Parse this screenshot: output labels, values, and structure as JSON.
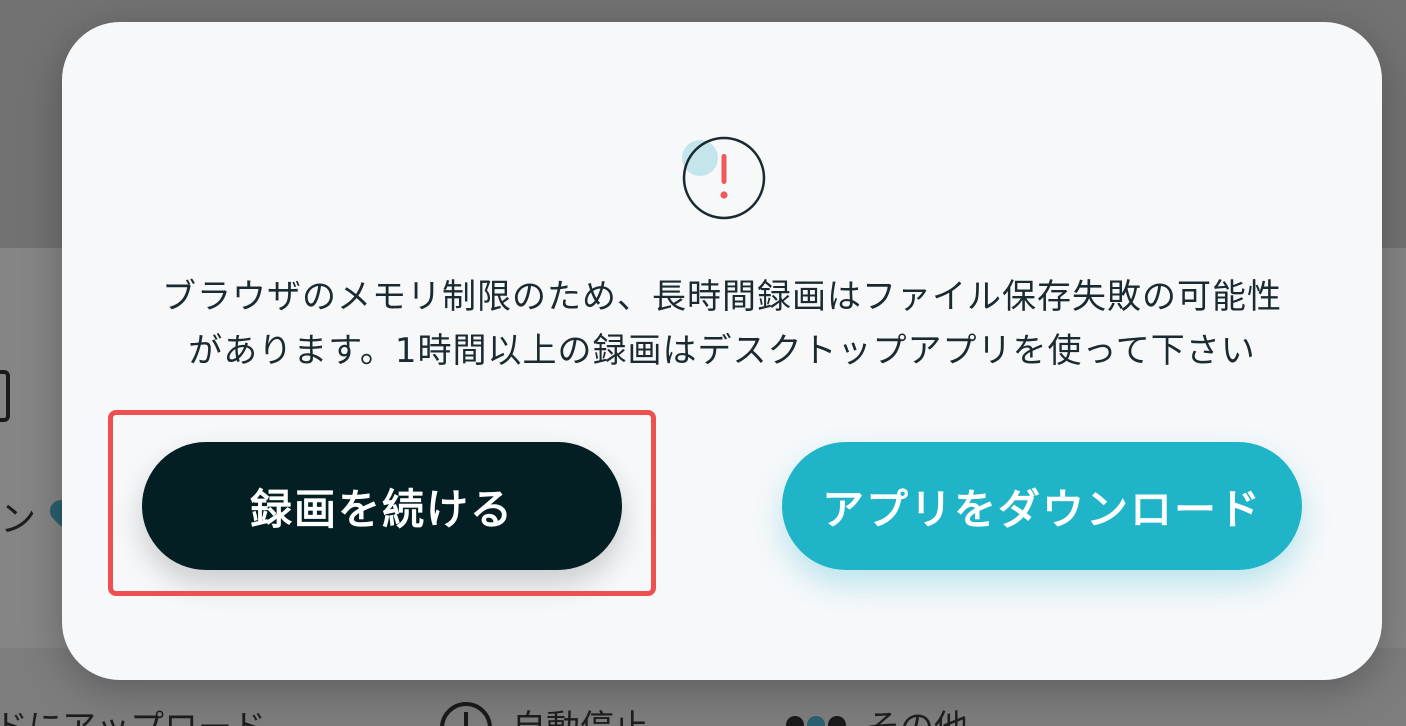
{
  "background": {
    "partial_text_left": "ン",
    "bottom_items": [
      {
        "label": "ドにアップロード"
      },
      {
        "label": "自動停止"
      },
      {
        "label": "その他"
      }
    ],
    "more_chevron": "⌄"
  },
  "dialog": {
    "icon": "alert-circle-icon",
    "icon_mark": "!",
    "message_line1": "ブラウザのメモリ制限のため、長時間録画はファイル保存失敗の可能性",
    "message_line2": "があります。1時間以上の録画はデスクトップアプリを使って下さい",
    "continue_label": "録画を続ける",
    "download_label": "アプリをダウンロード"
  },
  "colors": {
    "modal_bg": "#f6f8fa",
    "continue_bg": "#031f23",
    "download_bg": "#20b4c8",
    "highlight": "#ee5050",
    "alert_mark": "#ee5a5a"
  }
}
